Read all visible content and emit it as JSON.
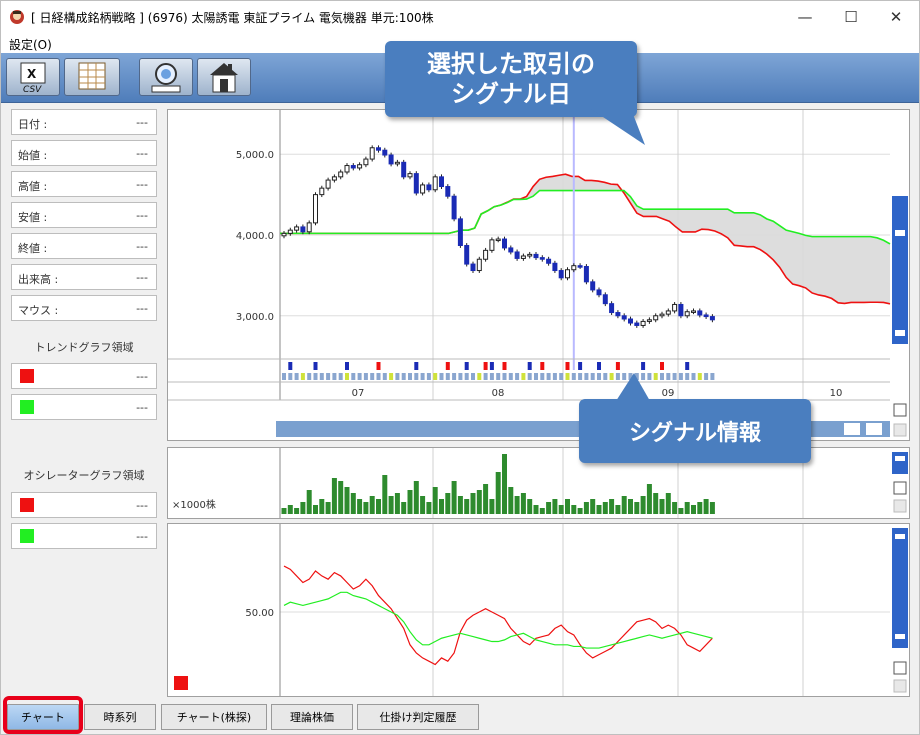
{
  "window": {
    "title": "[ 日経構成銘柄戦略 ] (6976) 太陽誘電 東証プライム 電気機器 単元:100株",
    "minimize_glyph": "—",
    "maximize_glyph": "☐",
    "close_glyph": "✕"
  },
  "menu": {
    "settings": "設定(O)"
  },
  "toolbar": {
    "csv_label": "CSV"
  },
  "left_panel": {
    "info_rows": [
      {
        "label": "日付 :",
        "value": "---"
      },
      {
        "label": "始値 :",
        "value": "---"
      },
      {
        "label": "高値 :",
        "value": "---"
      },
      {
        "label": "安値 :",
        "value": "---"
      },
      {
        "label": "終値 :",
        "value": "---"
      },
      {
        "label": "出来高 :",
        "value": "---"
      },
      {
        "label": "マウス :",
        "value": "---"
      }
    ],
    "trend_title": "トレンドグラフ領域",
    "trend_legend": [
      {
        "color": "#ee1111",
        "value": "---"
      },
      {
        "color": "#22ee22",
        "value": "---"
      }
    ],
    "osc_title": "オシレーターグラフ領域",
    "osc_legend": [
      {
        "color": "#ee1111",
        "value": "---"
      },
      {
        "color": "#22ee22",
        "value": "---"
      }
    ]
  },
  "annotations": {
    "signal_day": "選択した取引の\nシグナル日",
    "signal_info": "シグナル情報"
  },
  "tabs": [
    "チャート",
    "時系列",
    "チャート(株探)",
    "理論株価",
    "仕掛け判定履歴"
  ],
  "chart_data": [
    {
      "type": "candlestick",
      "y_ticks": [
        "5,000.0",
        "4,000.0",
        "3,000.0"
      ],
      "x_labels": [
        "07",
        "08",
        "09",
        "10"
      ],
      "ylim": [
        2700,
        5300
      ],
      "closes": [
        4020,
        4060,
        4100,
        4040,
        4150,
        4500,
        4580,
        4680,
        4720,
        4780,
        4860,
        4830,
        4870,
        4940,
        5080,
        5050,
        4990,
        4880,
        4900,
        4720,
        4760,
        4520,
        4620,
        4560,
        4720,
        4600,
        4480,
        4200,
        3870,
        3640,
        3560,
        3700,
        3810,
        3940,
        3950,
        3840,
        3790,
        3710,
        3740,
        3760,
        3720,
        3700,
        3650,
        3560,
        3470,
        3570,
        3620,
        3610,
        3420,
        3320,
        3260,
        3150,
        3040,
        3000,
        2960,
        2910,
        2880,
        2930,
        2950,
        3000,
        3020,
        3060,
        3140,
        3000,
        3050,
        3060,
        3010,
        2990,
        2950
      ],
      "colors": {
        "bear": "#1a2bb5",
        "bull": "#ffffff",
        "cloud": "#d9d9d9",
        "red_line": "#ee1111",
        "green_line": "#22ee22",
        "signal_line": "#b9b9ff"
      },
      "signal_index": 46
    },
    {
      "type": "signal_strip",
      "markers": [
        {
          "i": 1,
          "color": "#1a2bb5"
        },
        {
          "i": 5,
          "color": "#1a2bb5"
        },
        {
          "i": 10,
          "color": "#1a2bb5"
        },
        {
          "i": 15,
          "color": "#ee1111"
        },
        {
          "i": 21,
          "color": "#1a2bb5"
        },
        {
          "i": 26,
          "color": "#ee1111"
        },
        {
          "i": 29,
          "color": "#1a2bb5"
        },
        {
          "i": 32,
          "color": "#ee1111"
        },
        {
          "i": 33,
          "color": "#1a2bb5"
        },
        {
          "i": 35,
          "color": "#ee1111"
        },
        {
          "i": 39,
          "color": "#1a2bb5"
        },
        {
          "i": 41,
          "color": "#ee1111"
        },
        {
          "i": 45,
          "color": "#ee1111"
        },
        {
          "i": 47,
          "color": "#1a2bb5"
        },
        {
          "i": 50,
          "color": "#1a2bb5"
        },
        {
          "i": 53,
          "color": "#ee1111"
        },
        {
          "i": 57,
          "color": "#1a2bb5"
        },
        {
          "i": 60,
          "color": "#ee1111"
        },
        {
          "i": 64,
          "color": "#1a2bb5"
        }
      ]
    },
    {
      "type": "bar",
      "unit_label": "×1000株",
      "color": "#2e8b2e",
      "values": [
        2,
        3,
        2,
        4,
        8,
        3,
        5,
        4,
        12,
        11,
        9,
        7,
        5,
        4,
        6,
        5,
        13,
        6,
        7,
        4,
        8,
        11,
        6,
        4,
        9,
        5,
        7,
        11,
        6,
        5,
        7,
        8,
        10,
        5,
        14,
        20,
        9,
        6,
        7,
        5,
        3,
        2,
        4,
        5,
        3,
        5,
        3,
        2,
        4,
        5,
        3,
        4,
        5,
        3,
        6,
        5,
        4,
        6,
        10,
        7,
        5,
        7,
        4,
        2,
        4,
        3,
        4,
        5,
        4
      ]
    },
    {
      "type": "line",
      "y_tick": "50.00",
      "ylim": [
        0,
        100
      ],
      "series": [
        {
          "color": "#ee1111",
          "values": [
            78,
            76,
            72,
            68,
            70,
            75,
            72,
            70,
            74,
            72,
            68,
            64,
            66,
            70,
            66,
            60,
            56,
            52,
            46,
            40,
            30,
            25,
            22,
            20,
            18,
            22,
            20,
            25,
            38,
            45,
            48,
            50,
            52,
            50,
            48,
            46,
            40,
            36,
            32,
            30,
            34,
            35,
            36,
            40,
            42,
            38,
            36,
            30,
            25,
            22,
            24,
            26,
            28,
            32,
            36,
            40,
            44,
            45,
            46,
            44,
            40,
            42,
            40,
            36,
            30,
            28,
            26,
            30,
            34
          ]
        },
        {
          "color": "#22ee22",
          "values": [
            54,
            56,
            55,
            54,
            55,
            56,
            57,
            58,
            60,
            62,
            62,
            60,
            59,
            58,
            56,
            54,
            52,
            50,
            48,
            44,
            38,
            33,
            30,
            30,
            32,
            34,
            35,
            36,
            37,
            36,
            35,
            34,
            33,
            32,
            32,
            33,
            35,
            36,
            37,
            35,
            33,
            32,
            31,
            30,
            30,
            30,
            29,
            29,
            28,
            28,
            28,
            29,
            30,
            31,
            32,
            33,
            34,
            35,
            36,
            35,
            34,
            35,
            36,
            37,
            38,
            37,
            36,
            35,
            34
          ]
        }
      ]
    }
  ]
}
